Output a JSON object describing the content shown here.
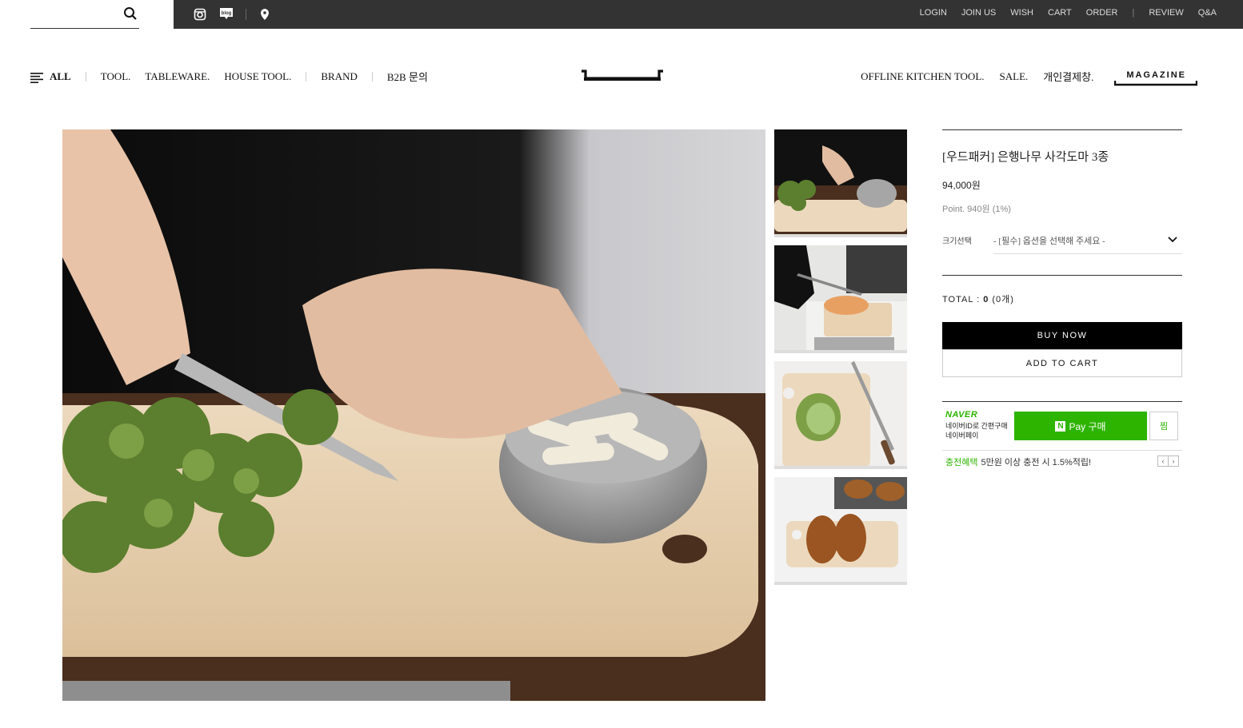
{
  "top": {
    "util_links": [
      "LOGIN",
      "JOIN US",
      "WISH",
      "CART",
      "ORDER",
      "REVIEW",
      "Q&A"
    ],
    "icons": [
      "search-icon",
      "instagram-icon",
      "blog-icon",
      "location-pin-icon"
    ]
  },
  "nav": {
    "all": "ALL",
    "left": [
      "TOOL.",
      "TABLEWARE.",
      "HOUSE TOOL.",
      "BRAND",
      "B2B 문의"
    ],
    "right": [
      "OFFLINE KITCHEN TOOL.",
      "SALE.",
      "개인결제창.",
      "MAGAZINE"
    ]
  },
  "product": {
    "title": "[우드패커] 은행나무 사각도마 3종",
    "price": "94,000원",
    "point": "Point. 940원 (1%)",
    "option_label": "크기선택",
    "option_placeholder": "- [필수] 옵션을 선택해 주세요 -",
    "total_label": "TOTAL : ",
    "total_value": "0",
    "total_count": "(0개)",
    "buy_now": "BUY NOW",
    "add_to_cart": "ADD TO CART"
  },
  "naver": {
    "brand": "NAVER",
    "desc": "네이버ID로 간편구매 네이버페이",
    "pay_label": "Pay 구매",
    "pay_n": "N",
    "wish_label": "찜",
    "benefit_title": "충전혜택",
    "benefit_text": "5만원 이상 충전 시 1.5%적립!"
  },
  "colors": {
    "topbar": "#333333",
    "naver_green": "#2db400",
    "buy_bg": "#000000"
  }
}
